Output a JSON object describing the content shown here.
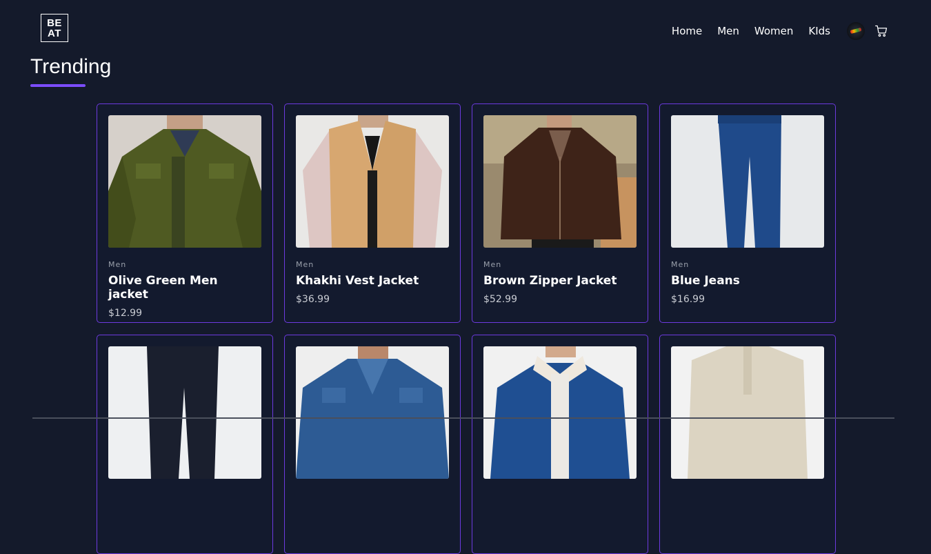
{
  "brand": {
    "line1": "BE",
    "line2": "AT"
  },
  "nav": {
    "items": [
      {
        "label": "Home"
      },
      {
        "label": "Men"
      },
      {
        "label": "Women"
      },
      {
        "label": "KIds"
      }
    ],
    "icons": {
      "avatar": "user-avatar-icon",
      "cart": "cart-icon"
    }
  },
  "page": {
    "title": "Trending",
    "accent": "#7c4dff",
    "background": "#141a2b",
    "card_border": "#6d3ae0"
  },
  "products": [
    {
      "category": "Men",
      "name": "Olive Green Men jacket",
      "price": "$12.99"
    },
    {
      "category": "Men",
      "name": "Khakhi Vest Jacket",
      "price": "$36.99"
    },
    {
      "category": "Men",
      "name": "Brown Zipper Jacket",
      "price": "$52.99"
    },
    {
      "category": "Men",
      "name": "Blue Jeans",
      "price": "$16.99"
    },
    {
      "category": "",
      "name": "",
      "price": ""
    },
    {
      "category": "",
      "name": "",
      "price": ""
    },
    {
      "category": "",
      "name": "",
      "price": ""
    },
    {
      "category": "",
      "name": "",
      "price": ""
    }
  ]
}
